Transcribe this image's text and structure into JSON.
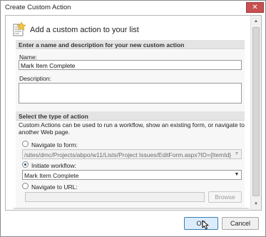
{
  "window": {
    "title": "Create Custom Action",
    "close_glyph": "✕"
  },
  "header": {
    "text": "Add a custom action to your list",
    "icon": "custom-action-icon"
  },
  "section_name": {
    "heading": "Enter a name and description for your new custom action",
    "name_label": "Name:",
    "name_value": "Mark Item Complete",
    "description_label": "Description:",
    "description_value": ""
  },
  "section_action": {
    "heading": "Select the type of action",
    "description": "Custom Actions can be used to run a workflow, show an existing form, or navigate to another Web page.",
    "options": {
      "navigate_form": {
        "label": "Navigate to form:",
        "selected": false,
        "value": "/sites/dmc/Projects/abpo/w11/Lists/Project Issues/EditForm.aspx?ID={ItemId}"
      },
      "initiate_workflow": {
        "label": "Initiate workflow:",
        "selected": true,
        "value": "Mark Item Complete"
      },
      "navigate_url": {
        "label": "Navigate to URL:",
        "selected": false,
        "value": "",
        "browse_label": "Browse"
      }
    }
  },
  "footer": {
    "ok_label": "OK",
    "cancel_label": "Cancel"
  },
  "colors": {
    "section_header_bg": "#e4e4e4",
    "section_body_bg": "#f7f7f7",
    "ok_border": "#3c7fb1",
    "close_button": "#c75050"
  }
}
